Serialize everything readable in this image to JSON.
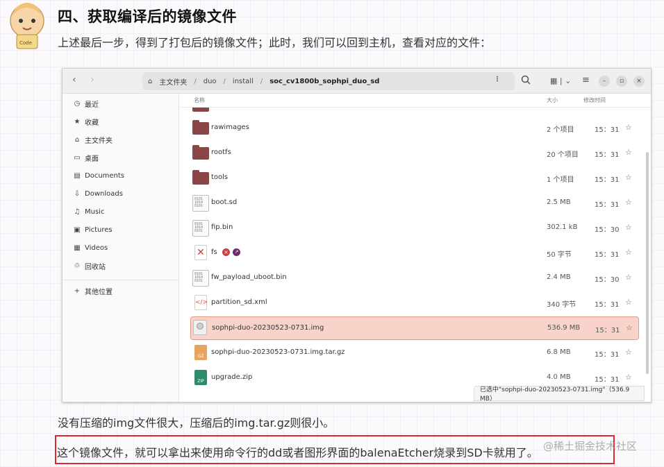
{
  "heading": "四、获取编译后的镜像文件",
  "para1": "上述最后一步，得到了打包后的镜像文件；此时，我们可以回到主机，查看对应的文件：",
  "window": {
    "path": [
      "主文件夹",
      "duo",
      "install",
      "soc_cv1800b_sophpi_duo_sd"
    ],
    "sidebar": [
      {
        "icon": "clock-icon",
        "glyph": "◷",
        "label": "最近"
      },
      {
        "icon": "star-icon",
        "glyph": "★",
        "label": "收藏"
      },
      {
        "icon": "home-icon",
        "glyph": "⌂",
        "label": "主文件夹"
      },
      {
        "icon": "desktop-icon",
        "glyph": "▭",
        "label": "桌面"
      },
      {
        "icon": "document-icon",
        "glyph": "▤",
        "label": "Documents"
      },
      {
        "icon": "download-icon",
        "glyph": "⇩",
        "label": "Downloads"
      },
      {
        "icon": "music-icon",
        "glyph": "♫",
        "label": "Music"
      },
      {
        "icon": "pictures-icon",
        "glyph": "▣",
        "label": "Pictures"
      },
      {
        "icon": "video-icon",
        "glyph": "▦",
        "label": "Videos"
      },
      {
        "icon": "trash-icon",
        "glyph": "♲",
        "label": "回收站"
      },
      {
        "icon": "plus-icon",
        "glyph": "+",
        "label": "其他位置"
      }
    ],
    "columns": {
      "name": "名称",
      "size": "大小",
      "modified": "修改时间"
    },
    "files": [
      {
        "name": "rawimages",
        "type": "folder",
        "size": "2 个项目",
        "time": "15：31"
      },
      {
        "name": "rootfs",
        "type": "folder",
        "size": "20 个项目",
        "time": "15：31"
      },
      {
        "name": "tools",
        "type": "folder",
        "size": "1 个项目",
        "time": "15：31"
      },
      {
        "name": "boot.sd",
        "type": "binary",
        "size": "2.5 MB",
        "time": "15：31"
      },
      {
        "name": "fip.bin",
        "type": "binary",
        "size": "302.1 kB",
        "time": "15：30"
      },
      {
        "name": "fs",
        "type": "broken-link",
        "size": "50 字节",
        "time": "15：31"
      },
      {
        "name": "fw_payload_uboot.bin",
        "type": "binary",
        "size": "2.4 MB",
        "time": "15：30"
      },
      {
        "name": "partition_sd.xml",
        "type": "xml",
        "size": "340 字节",
        "time": "15：31"
      },
      {
        "name": "sophpi-duo-20230523-0731.img",
        "type": "disk-image",
        "size": "536.9 MB",
        "time": "15：31",
        "selected": true
      },
      {
        "name": "sophpi-duo-20230523-0731.img.tar.gz",
        "type": "archive",
        "size": "6.8 MB",
        "time": "15：31"
      },
      {
        "name": "upgrade.zip",
        "type": "zip",
        "size": "4.0 MB",
        "time": "15：31"
      }
    ],
    "status": "已选中\"sophpi-duo-20230523-0731.img\"（536.9 MB）"
  },
  "para2": "没有压缩的img文件很大，压缩后的img.tar.gz则很小。",
  "para3": "这个镜像文件，就可以拿出来使用命令行的dd或者图形界面的balenaEtcher烧录到SD卡就用了。",
  "watermark": "@稀土掘金技术社区",
  "colors": {
    "highlight_bg": "#f9d3c9",
    "highlight_border": "#e59a85",
    "folder": "#8a4547",
    "callout_border": "#e0282c"
  }
}
